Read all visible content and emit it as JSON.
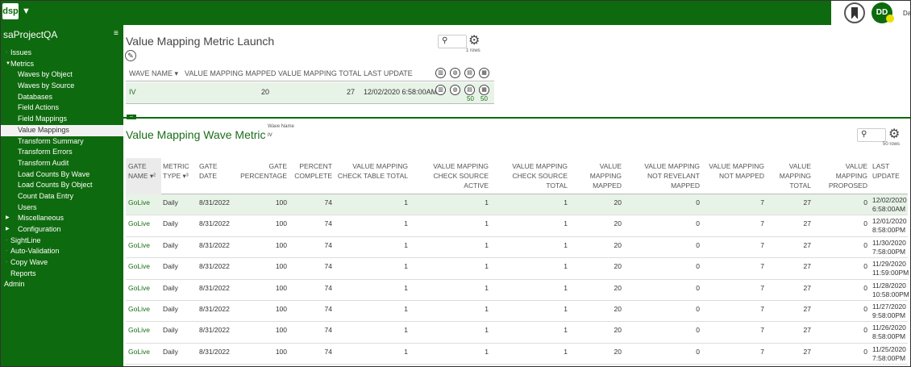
{
  "topbar": {
    "logo": "dsp",
    "caret": "▼",
    "avatar": "DD",
    "user_truncated": "Da"
  },
  "sidebar": {
    "project": "saProjectQA",
    "menu_icon": "≡",
    "items": [
      {
        "label": "Issues",
        "indent": 1,
        "mark": "·",
        "active": false
      },
      {
        "label": "Metrics",
        "indent": 1,
        "mark": "▼",
        "active": false
      },
      {
        "label": "Waves by Object",
        "indent": 2,
        "mark": "",
        "active": false
      },
      {
        "label": "Waves by Source",
        "indent": 2,
        "mark": "",
        "active": false
      },
      {
        "label": "Databases",
        "indent": 2,
        "mark": "",
        "active": false
      },
      {
        "label": "Field Actions",
        "indent": 2,
        "mark": "",
        "active": false
      },
      {
        "label": "Field Mappings",
        "indent": 2,
        "mark": "",
        "active": false
      },
      {
        "label": "Value Mappings",
        "indent": 2,
        "mark": "",
        "active": true
      },
      {
        "label": "Transform Summary",
        "indent": 2,
        "mark": "",
        "active": false
      },
      {
        "label": "Transform Errors",
        "indent": 2,
        "mark": "",
        "active": false
      },
      {
        "label": "Transform Audit",
        "indent": 2,
        "mark": "",
        "active": false
      },
      {
        "label": "Load Counts By Wave",
        "indent": 2,
        "mark": "",
        "active": false
      },
      {
        "label": "Load Counts By Object",
        "indent": 2,
        "mark": "",
        "active": false
      },
      {
        "label": "Count Data Entry",
        "indent": 2,
        "mark": "",
        "active": false
      },
      {
        "label": "Users",
        "indent": 2,
        "mark": "",
        "active": false
      },
      {
        "label": "Miscellaneous",
        "indent": 2,
        "mark": "▶",
        "active": false
      },
      {
        "label": "Configuration",
        "indent": 2,
        "mark": "▶",
        "active": false
      },
      {
        "label": "SightLine",
        "indent": 1,
        "mark": "·",
        "active": false
      },
      {
        "label": "Auto-Validation",
        "indent": 1,
        "mark": "·",
        "active": false
      },
      {
        "label": "Copy Wave",
        "indent": 1,
        "mark": "·",
        "active": false
      },
      {
        "label": "Reports",
        "indent": 1,
        "mark": "",
        "active": false
      },
      {
        "label": "Admin",
        "indent": 0,
        "mark": "",
        "active": false
      }
    ]
  },
  "launch": {
    "title": "Value Mapping Metric Launch",
    "rows_label": "1 rows",
    "headers": [
      "WAVE NAME ▾",
      "VALUE MAPPING MAPPED",
      "VALUE MAPPING TOTAL",
      "LAST UPDATE"
    ],
    "row": {
      "wave_name": "IV",
      "mapped": "20",
      "total": "27",
      "last_update": "12/02/2020 6:58:00AM"
    },
    "icon_counts": [
      "50",
      "50"
    ]
  },
  "wave_metric": {
    "title": "Value Mapping Wave Metric",
    "wave_name_label": "Wave Name",
    "wave_name_value": "IV",
    "rows_label": "50 rows",
    "headers": [
      "GATE NAME ▾²",
      "METRIC TYPE ▾³",
      "GATE DATE",
      "GATE PERCENTAGE",
      "PERCENT COMPLETE",
      "VALUE MAPPING CHECK TABLE TOTAL",
      "VALUE MAPPING CHECK SOURCE ACTIVE",
      "VALUE MAPPING CHECK SOURCE TOTAL",
      "VALUE MAPPING MAPPED",
      "VALUE MAPPING NOT REVELANT MAPPED",
      "VALUE MAPPING NOT MAPPED",
      "VALUE MAPPING TOTAL",
      "VALUE MAPPING PROPOSED",
      "LAST UPDATE"
    ],
    "rows": [
      [
        "GoLive",
        "Daily",
        "8/31/2022",
        "100",
        "74",
        "1",
        "1",
        "1",
        "20",
        "0",
        "7",
        "27",
        "0",
        "12/02/2020",
        "6:58:00AM"
      ],
      [
        "GoLive",
        "Daily",
        "8/31/2022",
        "100",
        "74",
        "1",
        "1",
        "1",
        "20",
        "0",
        "7",
        "27",
        "0",
        "12/01/2020",
        "8:58:00PM"
      ],
      [
        "GoLive",
        "Daily",
        "8/31/2022",
        "100",
        "74",
        "1",
        "1",
        "1",
        "20",
        "0",
        "7",
        "27",
        "0",
        "11/30/2020",
        "7:58:00PM"
      ],
      [
        "GoLive",
        "Daily",
        "8/31/2022",
        "100",
        "74",
        "1",
        "1",
        "1",
        "20",
        "0",
        "7",
        "27",
        "0",
        "11/29/2020",
        "11:59:00PM"
      ],
      [
        "GoLive",
        "Daily",
        "8/31/2022",
        "100",
        "74",
        "1",
        "1",
        "1",
        "20",
        "0",
        "7",
        "27",
        "0",
        "11/28/2020",
        "10:58:00PM"
      ],
      [
        "GoLive",
        "Daily",
        "8/31/2022",
        "100",
        "74",
        "1",
        "1",
        "1",
        "20",
        "0",
        "7",
        "27",
        "0",
        "11/27/2020",
        "9:58:00PM"
      ],
      [
        "GoLive",
        "Daily",
        "8/31/2022",
        "100",
        "74",
        "1",
        "1",
        "1",
        "20",
        "0",
        "7",
        "27",
        "0",
        "11/26/2020",
        "8:58:00PM"
      ],
      [
        "GoLive",
        "Daily",
        "8/31/2022",
        "100",
        "74",
        "1",
        "1",
        "1",
        "20",
        "0",
        "7",
        "27",
        "0",
        "11/25/2020",
        "7:58:00PM"
      ]
    ]
  }
}
